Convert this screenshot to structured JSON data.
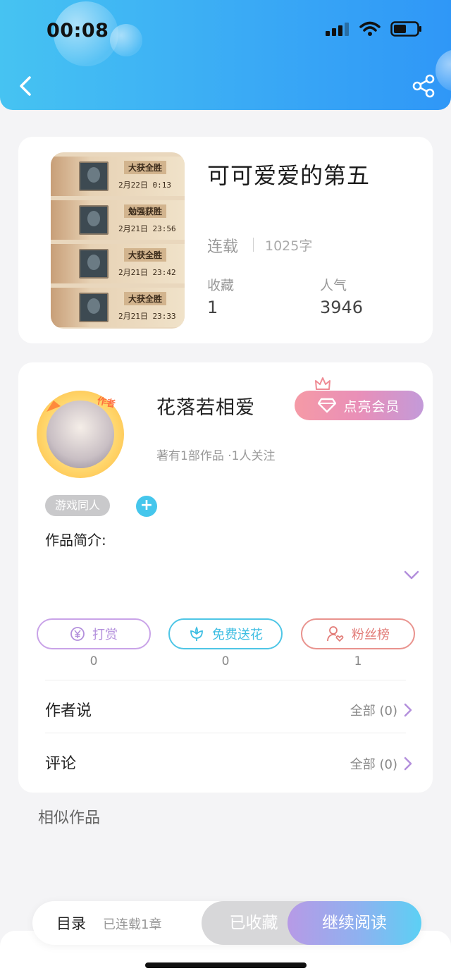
{
  "status_bar": {
    "time": "00:08"
  },
  "header": {
    "back_icon": "chevron-left-icon",
    "share_icon": "share-icon"
  },
  "book": {
    "title": "可可爱爱的第五",
    "status": "连载",
    "word_count": "1025字",
    "favorites_label": "收藏",
    "favorites_value": "1",
    "popularity_label": "人气",
    "popularity_value": "3946",
    "cover_rows": [
      {
        "tag": "大获全胜",
        "date": "2月22日 0:13"
      },
      {
        "tag": "勉强获胜",
        "date": "2月21日 23:56"
      },
      {
        "tag": "大获全胜",
        "date": "2月21日 23:42"
      },
      {
        "tag": "大获全胜",
        "date": "2月21日 23:33"
      }
    ]
  },
  "author": {
    "badge": "作者",
    "name": "花落若相爱",
    "meta": "著有1部作品 ·1人关注",
    "vip_label": "点亮会员",
    "tag": "游戏同人",
    "add_tag": "+",
    "intro_label": "作品简介:"
  },
  "actions": [
    {
      "label": "打赏",
      "count": "0",
      "color": "#c9a3e8"
    },
    {
      "label": "免费送花",
      "count": "0",
      "color": "#4fc6e6"
    },
    {
      "label": "粉丝榜",
      "count": "1",
      "color": "#e9938e"
    }
  ],
  "sections": {
    "author_says": {
      "label": "作者说",
      "link": "全部 (0)"
    },
    "comments": {
      "label": "评论",
      "link": "全部 (0)"
    }
  },
  "similar_label": "相似作品",
  "bottom": {
    "toc_label": "目录",
    "chapter_status": "已连载1章",
    "collected_label": "已收藏",
    "read_label": "继续阅读"
  },
  "colors": {
    "header_start": "#46c3f2",
    "header_end": "#2f97f7",
    "accent_purple": "#b38fdc",
    "accent_cyan": "#45c6ec"
  }
}
